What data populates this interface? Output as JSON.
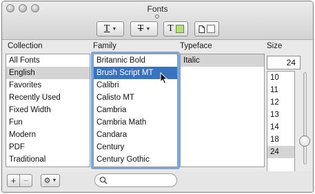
{
  "window": {
    "title": "Fonts"
  },
  "toolbar": {
    "underline_glyph": "T",
    "strikethrough_glyph": "T",
    "text_color_glyph": "T",
    "text_color": "#b4e26e",
    "doc_color": "#ffffff"
  },
  "headers": {
    "collection": "Collection",
    "family": "Family",
    "typeface": "Typeface",
    "size": "Size"
  },
  "collections": [
    "All Fonts",
    "English",
    "Favorites",
    "Recently Used",
    "Fixed Width",
    "Fun",
    "Modern",
    "PDF",
    "Traditional"
  ],
  "collection_selected": "English",
  "families": [
    "Britannic Bold",
    "Brush Script MT",
    "Calibri",
    "Calisto MT",
    "Cambria",
    "Cambria Math",
    "Candara",
    "Century",
    "Century Gothic"
  ],
  "family_selected": "Brush Script MT",
  "typefaces": [
    "Italic"
  ],
  "size": {
    "value": "24",
    "list": [
      "10",
      "11",
      "12",
      "13",
      "14",
      "18",
      "24"
    ],
    "selected": "24"
  },
  "colors": {
    "selection_blue": "#3a72c2",
    "focus_ring": "#7ba7dc"
  }
}
